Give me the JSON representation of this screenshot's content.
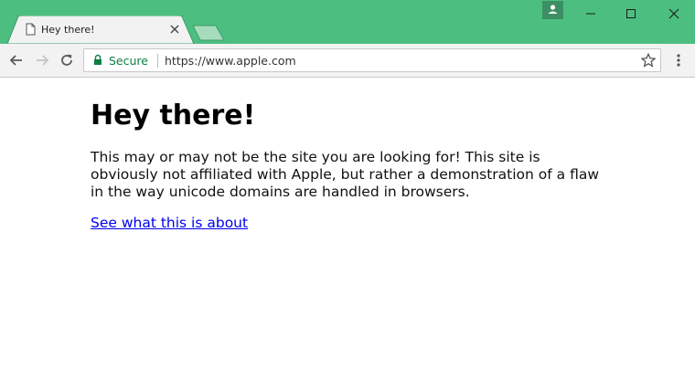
{
  "browser": {
    "tab": {
      "title": "Hey there!",
      "page_icon": "page-icon",
      "close_icon": "close-icon"
    },
    "new_tab_icon": "new-tab-icon",
    "profile_icon": "person-icon",
    "window_controls": [
      "minimize-icon",
      "maximize-icon",
      "close-window-icon"
    ],
    "nav": {
      "back_icon": "back-arrow-icon",
      "forward_icon": "forward-arrow-icon",
      "reload_icon": "reload-icon"
    },
    "omnibox": {
      "security_label": "Secure",
      "url": "https://www.apple.com",
      "lock_icon": "lock-icon",
      "bookmark_icon": "star-icon"
    },
    "menu_icon": "more-vertical-icon",
    "colors": {
      "frame": "#4cbf80",
      "secure": "#0b8043",
      "link": "#0000ee"
    }
  },
  "page": {
    "heading": "Hey there!",
    "paragraph": "This may or may not be the site you are looking for! This site is obviously not affiliated with Apple, but rather a demonstration of a flaw in the way unicode domains are handled in browsers.",
    "link_text": "See what this is about"
  }
}
